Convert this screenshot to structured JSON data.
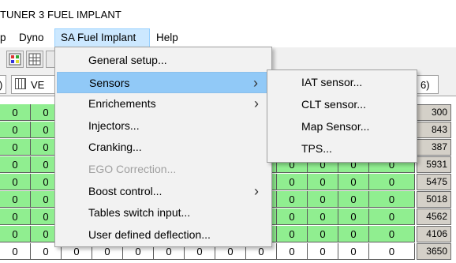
{
  "window": {
    "title": "TUNER 3 FUEL IMPLANT"
  },
  "menubar": [
    {
      "label": "p",
      "x": 0
    },
    {
      "label": "Dyno"
    },
    {
      "label": "SA Fuel Implant"
    },
    {
      "label": "Help"
    }
  ],
  "tabs": {
    "left": "VE",
    "right": "6)"
  },
  "main_menu": [
    {
      "label": "General setup...",
      "submenu": false,
      "disabled": false
    },
    {
      "label": "Sensors",
      "submenu": true,
      "disabled": false,
      "highlighted": true
    },
    {
      "label": "Enrichements",
      "submenu": true,
      "disabled": false
    },
    {
      "label": "Injectors...",
      "submenu": false,
      "disabled": false
    },
    {
      "label": "Cranking...",
      "submenu": false,
      "disabled": false
    },
    {
      "label": "EGO Correction...",
      "submenu": false,
      "disabled": true
    },
    {
      "label": "Boost  control...",
      "submenu": true,
      "disabled": false
    },
    {
      "label": "Tables switch input...",
      "submenu": false,
      "disabled": false
    },
    {
      "label": "User defined deflection...",
      "submenu": false,
      "disabled": false
    }
  ],
  "sensors_menu": [
    {
      "label": "IAT sensor..."
    },
    {
      "label": "CLT sensor..."
    },
    {
      "label": "Map Sensor..."
    },
    {
      "label": "TPS..."
    }
  ],
  "grid": {
    "cell_value": "0",
    "rpm": [
      "300",
      "843",
      "387",
      "5931",
      "5475",
      "5018",
      "4562",
      "4106",
      "3650"
    ]
  },
  "colors": {
    "cell": "#90ee90",
    "highlight": "#91c9f7",
    "menubar_active": "#cce8ff"
  }
}
